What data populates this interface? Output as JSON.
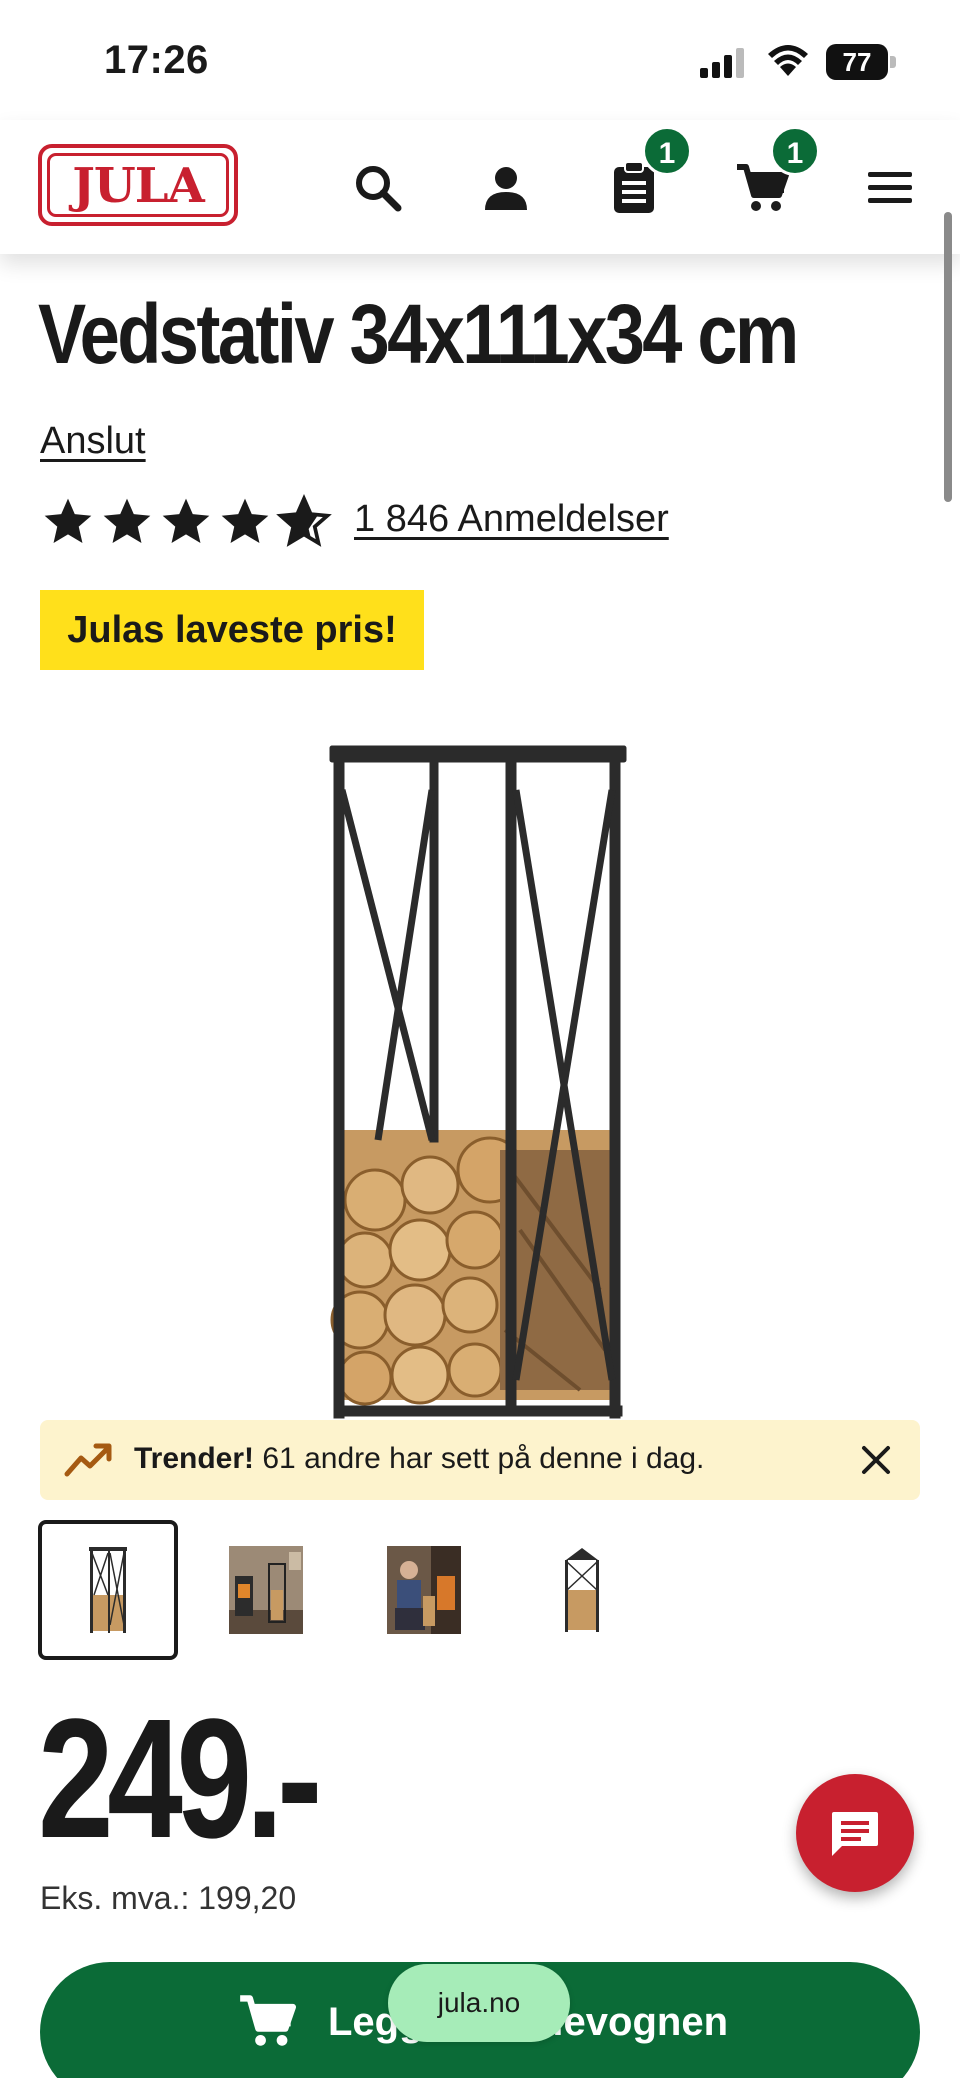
{
  "status_bar": {
    "time": "17:26",
    "battery": "77"
  },
  "header": {
    "logo_text": "JULA",
    "list_badge": "1",
    "cart_badge": "1",
    "brand_color": "#c8202f",
    "badge_color": "#0b6b37"
  },
  "product": {
    "title": "Vedstativ 34x111x34 cm",
    "brand_link": "Anslut",
    "rating_stars": 4.5,
    "reviews_label": "1 846 Anmeldelser",
    "promo_label": "Julas laveste pris!",
    "promo_color": "#ffe01b"
  },
  "trend_banner": {
    "strong": "Trender!",
    "text": "61 andre har sett på denne i dag."
  },
  "thumbnails": [
    {
      "label": "Produktbilde 1",
      "active": true
    },
    {
      "label": "Produktbilde 2",
      "active": false
    },
    {
      "label": "Produktbilde 3",
      "active": false
    },
    {
      "label": "Produktbilde 4",
      "active": false
    }
  ],
  "price": {
    "amount": "249.-",
    "vat_label": "Eks. mva.: 199,20"
  },
  "cart_button": {
    "label": "Legg i handlevognen",
    "color": "#0b6b37"
  },
  "browser": {
    "url": "jula.no"
  }
}
